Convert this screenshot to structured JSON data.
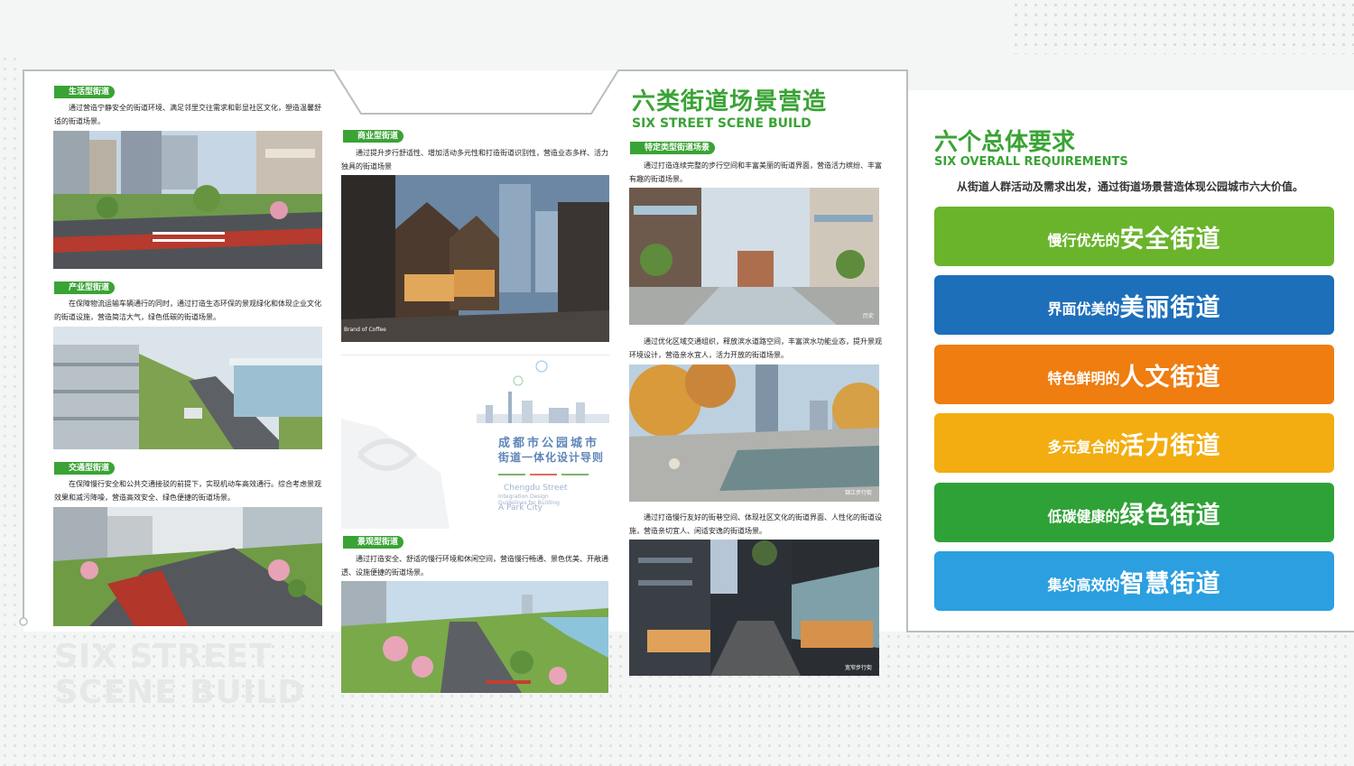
{
  "header": {
    "title": "六类街道场景营造",
    "subtitle": "SIX STREET SCENE BUILD"
  },
  "watermark": {
    "line1": "SIX STREET",
    "line2": "SCENE BUILD"
  },
  "left_column": [
    {
      "tag": "生活型街道",
      "desc": "通过营造宁静安全的街道环境、满足邻里交往需求和彰显社区文化，塑造温馨舒适的街道场景。"
    },
    {
      "tag": "产业型街道",
      "desc": "在保障物流运输车辆通行的同时，通过打造生态环保的景观绿化和体现企业文化的街道设施，营造简洁大气，绿色低碳的街道场景。"
    },
    {
      "tag": "交通型街道",
      "desc": "在保障慢行安全和公共交通接驳的前提下，实现机动车高效通行。综合考虑景观效果和减污降噪，营造高效安全、绿色便捷的街道场景。"
    }
  ],
  "middle_column": [
    {
      "tag": "商业型街道",
      "desc": "通过提升步行舒适性、增加活动多元性和打造街道识别性，营造业态多样、活力独具的街道场景",
      "caption": "Brand of Coffee"
    },
    {
      "tag": "景观型街道",
      "desc": "通过打造安全、舒适的慢行环境和休闲空间，营造慢行畅通、景色优美、开敞通透、设施便捷的街道场景。"
    }
  ],
  "cover": {
    "title_line1": "成都市公园城市",
    "title_line2": "街道一体化设计导则",
    "en_line1": "Chengdu Street",
    "en_line2": "Integration Design",
    "en_line3": "Guidelines for Building",
    "en_line4": "A Park City"
  },
  "right_column": [
    {
      "tag": "特定类型街道场景",
      "desc": "通过打造连续完整的步行空间和丰富美丽的街道界面，营造活力缤纷、丰富有趣的街道场景。",
      "caption": "历史"
    },
    {
      "desc": "通过优化区域交通组织，释放滨水道路空间，丰富滨水功能业态，提升景观环境设计，营造亲水宜人，活力开放的街道场景。",
      "caption": "锦江步行街"
    },
    {
      "desc": "通过打造慢行友好的街巷空间、体现社区文化的街道界面、人性化的街道设施，营造亲切宜人、闲适安逸的街道场景。",
      "caption": "宽窄步行街"
    }
  ],
  "requirements": {
    "title": "六个总体要求",
    "subtitle": "SIX OVERALL REQUIREMENTS",
    "desc": "从街道人群活动及需求出发，通过街道场景营造体现公园城市六大价值。",
    "items": [
      {
        "prefix": "慢行优先的",
        "main": "安全街道",
        "color": "#6ab42c"
      },
      {
        "prefix": "界面优美的",
        "main": "美丽街道",
        "color": "#1d6fba"
      },
      {
        "prefix": "特色鲜明的",
        "main": "人文街道",
        "color": "#ef7d10"
      },
      {
        "prefix": "多元复合的",
        "main": "活力街道",
        "color": "#f3ad10"
      },
      {
        "prefix": "低碳健康的",
        "main": "绿色街道",
        "color": "#2fa237"
      },
      {
        "prefix": "集约高效的",
        "main": "智慧街道",
        "color": "#2b9fe0"
      }
    ]
  }
}
